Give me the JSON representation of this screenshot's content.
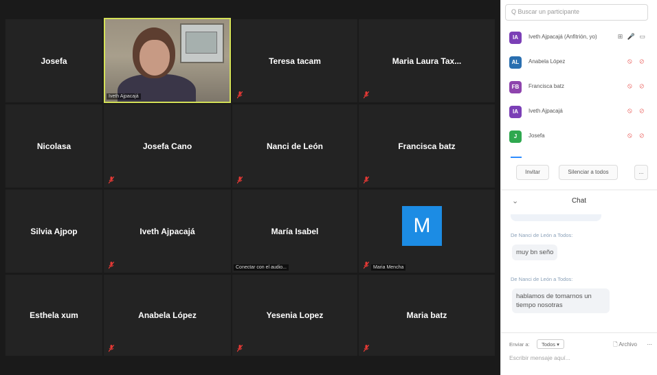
{
  "gallery": {
    "tiles": [
      {
        "name": "Josefa"
      },
      {
        "name": "",
        "caption": "Iveth Ajpacajá"
      },
      {
        "name": "Teresa tacam"
      },
      {
        "name": "Maria Laura Tax..."
      },
      {
        "name": "Nicolasa"
      },
      {
        "name": "Josefa Cano"
      },
      {
        "name": "Nanci de León"
      },
      {
        "name": "Francisca batz"
      },
      {
        "name": "Silvia Ajpop"
      },
      {
        "name": "Iveth Ajpacajá"
      },
      {
        "name": "María Isabel",
        "caption": "Conectar con el audio..."
      },
      {
        "name": "",
        "avatar_letter": "M",
        "caption": "Maria Mencha"
      },
      {
        "name": "Esthela xum"
      },
      {
        "name": "Anabela López"
      },
      {
        "name": "Yesenia Lopez"
      },
      {
        "name": "Maria batz"
      }
    ]
  },
  "participants": {
    "search_placeholder": "Q Buscar un participante",
    "list": [
      {
        "initials": "IA",
        "name": "Iveth Ajpacajá (Anfitrión, yo)",
        "color": "#7b3fb6",
        "host": true
      },
      {
        "initials": "AL",
        "name": "Anabela López",
        "color": "#2a6fb0",
        "host": false
      },
      {
        "initials": "FB",
        "name": "Francisca batz",
        "color": "#8e44ad",
        "host": false
      },
      {
        "initials": "IA",
        "name": "Iveth Ajpacajá",
        "color": "#7b3fb6",
        "host": false
      },
      {
        "initials": "J",
        "name": "Josefa",
        "color": "#2fa84f",
        "host": false
      }
    ],
    "invite_label": "Invitar",
    "mute_all_label": "Silenciar a todos",
    "more_label": "..."
  },
  "chat": {
    "title": "Chat",
    "collapse_icon": "chevron-down-icon",
    "messages": [
      {
        "meta": "De Nanci de León a Todos:",
        "text": "muy bn seño"
      },
      {
        "meta": "De Nanci de León a Todos:",
        "text": "hablamos de tomarnos un tiempo nosotras"
      }
    ],
    "send_to_label": "Enviar a:",
    "send_to_value": "Todos ▾",
    "file_label": "Archivo",
    "more_label": "...",
    "input_placeholder": "Escribir mensaje aquí..."
  },
  "colors": {
    "mute_red": "#e53935",
    "active_speaker": "#d4e157",
    "avatar_blue": "#1c8ce4"
  }
}
